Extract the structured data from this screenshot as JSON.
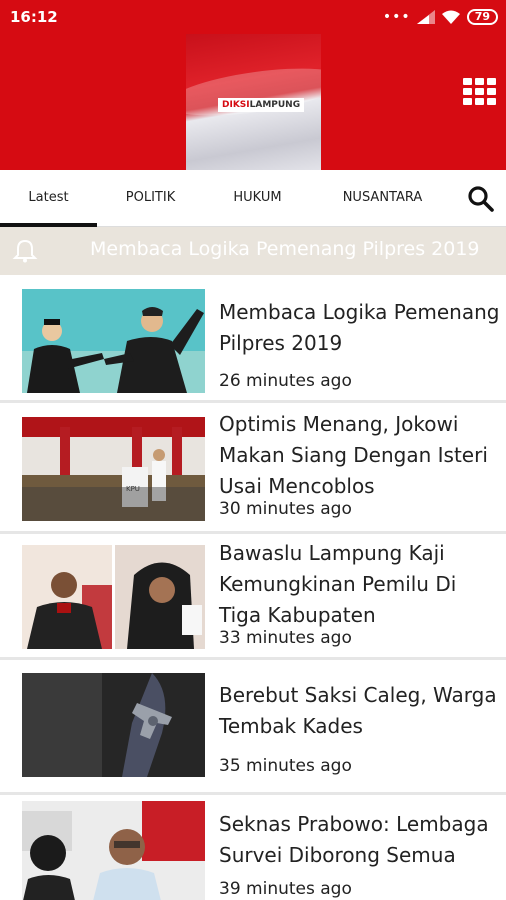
{
  "status": {
    "time": "16:12",
    "battery": "79"
  },
  "brand": {
    "logo_part1": "DIKSI",
    "logo_part2": "LAMPUNG"
  },
  "tabs": [
    {
      "label": "Latest"
    },
    {
      "label": "POLITIK"
    },
    {
      "label": "HUKUM"
    },
    {
      "label": "NUSANTARA"
    }
  ],
  "ticker": {
    "text": "Membaca Logika Pemenang Pilpres 2019"
  },
  "articles": [
    {
      "title": "Membaca Logika Pemenang Pilpres 2019",
      "time": "26 minutes ago"
    },
    {
      "title": "Optimis Menang, Jokowi Makan Siang Dengan Isteri Usai Mencoblos",
      "time": "30 minutes ago"
    },
    {
      "title": "Bawaslu Lampung Kaji Kemungkinan Pemilu Di Tiga Kabupaten",
      "time": "33 minutes ago"
    },
    {
      "title": "Berebut Saksi Caleg, Warga Tembak Kades",
      "time": "35 minutes ago"
    },
    {
      "title": "Seknas Prabowo: Lembaga Survei Diborong Semua",
      "time": "39 minutes ago"
    }
  ],
  "colors": {
    "brand_red": "#d60b12",
    "ticker_bg": "#e9e4dc"
  }
}
